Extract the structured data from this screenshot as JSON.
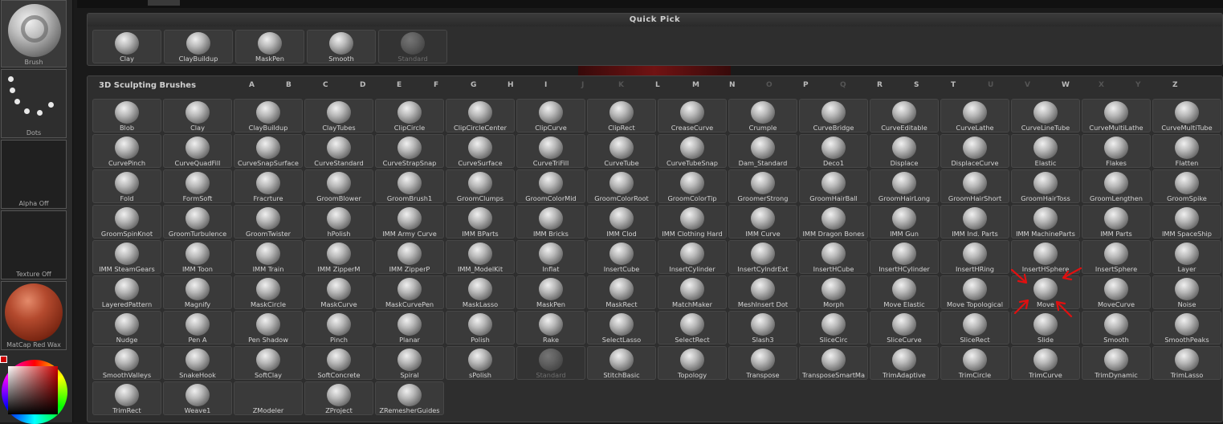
{
  "left_palette": {
    "brush_label": "Brush",
    "dots_label": "Dots",
    "alpha_label": "Alpha Off",
    "texture_label": "Texture Off",
    "matcap_label": "MatCap Red Wax"
  },
  "quick_pick": {
    "title": "Quick Pick",
    "items": [
      "Clay",
      "ClayBuildup",
      "MaskPen",
      "Smooth",
      "Standard"
    ]
  },
  "sculpt": {
    "title": "3D Sculpting Brushes",
    "letters": [
      "A",
      "B",
      "C",
      "D",
      "E",
      "F",
      "G",
      "H",
      "I",
      "J",
      "K",
      "L",
      "M",
      "N",
      "O",
      "P",
      "Q",
      "R",
      "S",
      "T",
      "U",
      "V",
      "W",
      "X",
      "Y",
      "Z"
    ],
    "rows": [
      [
        "Blob",
        "Clay",
        "ClayBuildup",
        "ClayTubes",
        "ClipCircle",
        "ClipCircleCenter",
        "ClipCurve",
        "ClipRect",
        "CreaseCurve",
        "Crumple",
        "CurveBridge",
        "CurveEditable",
        "CurveLathe",
        "CurveLineTube",
        "CurveMultiLathe",
        "CurveMultiTube"
      ],
      [
        "CurvePinch",
        "CurveQuadFill",
        "CurveSnapSurface",
        "CurveStandard",
        "CurveStrapSnap",
        "CurveSurface",
        "CurveTriFill",
        "CurveTube",
        "CurveTubeSnap",
        "Dam_Standard",
        "Deco1",
        "Displace",
        "DisplaceCurve",
        "Elastic",
        "Flakes",
        "Flatten"
      ],
      [
        "Fold",
        "FormSoft",
        "Fracrture",
        "GroomBlower",
        "GroomBrush1",
        "GroomClumps",
        "GroomColorMid",
        "GroomColorRoot",
        "GroomColorTip",
        "GroomerStrong",
        "GroomHairBall",
        "GroomHairLong",
        "GroomHairShort",
        "GroomHairToss",
        "GroomLengthen",
        "GroomSpike"
      ],
      [
        "GroomSpinKnot",
        "GroomTurbulence",
        "GroomTwister",
        "hPolish",
        "IMM Army Curve",
        "IMM BParts",
        "IMM Bricks",
        "IMM Clod",
        "IMM Clothing Hard",
        "IMM Curve",
        "IMM Dragon Bones",
        "IMM Gun",
        "IMM Ind. Parts",
        "IMM MachineParts",
        "IMM Parts",
        "IMM SpaceShip"
      ],
      [
        "IMM SteamGears",
        "IMM Toon",
        "IMM Train",
        "IMM ZipperM",
        "IMM ZipperP",
        "IMM_ModelKit",
        "Inflat",
        "InsertCube",
        "InsertCylinder",
        "InsertCylndrExt",
        "InsertHCube",
        "InsertHCylinder",
        "InsertHRing",
        "InsertHSphere",
        "InsertSphere",
        "Layer"
      ],
      [
        "LayeredPattern",
        "Magnify",
        "MaskCircle",
        "MaskCurve",
        "MaskCurvePen",
        "MaskLasso",
        "MaskPen",
        "MaskRect",
        "MatchMaker",
        "MeshInsert Dot",
        "Morph",
        "Move Elastic",
        "Move Topological",
        "Move",
        "MoveCurve",
        "Noise"
      ],
      [
        "Nudge",
        "Pen A",
        "Pen Shadow",
        "Pinch",
        "Planar",
        "Polish",
        "Rake",
        "SelectLasso",
        "SelectRect",
        "Slash3",
        "SliceCirc",
        "SliceCurve",
        "SliceRect",
        "Slide",
        "Smooth",
        "SmoothPeaks"
      ],
      [
        "SmoothValleys",
        "SnakeHook",
        "SoftClay",
        "SoftConcrete",
        "Spiral",
        "sPolish",
        "Standard",
        "StitchBasic",
        "Topology",
        "Transpose",
        "TransposeSmartMa",
        "TrimAdaptive",
        "TrimCircle",
        "TrimCurve",
        "TrimDynamic",
        "TrimLasso"
      ],
      [
        "TrimRect",
        "Weave1",
        "ZModeler",
        "ZProject",
        "ZRemesherGuides"
      ]
    ]
  },
  "colors": {
    "annotation": "#e01010",
    "panel_bg": "#2e2e2e",
    "cell_bg": "#3a3a3a"
  }
}
